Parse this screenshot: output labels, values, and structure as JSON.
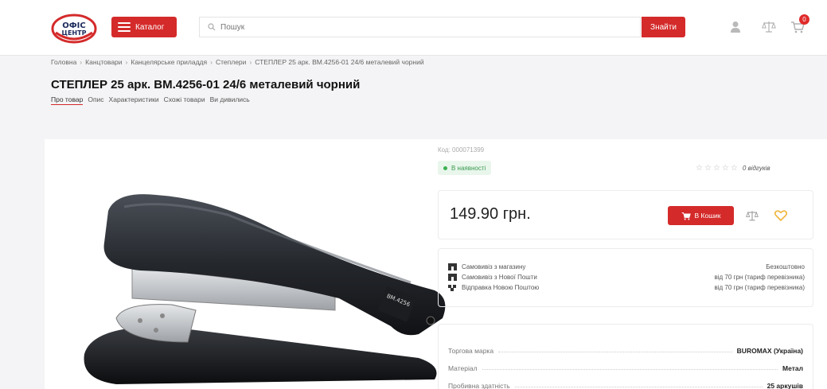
{
  "header": {
    "logo_line1": "ОФІС",
    "logo_line2": "ЦЕНТР",
    "catalog_label": "Каталог",
    "search_placeholder": "Пошук",
    "search_button": "Знайти",
    "cart_count": "0"
  },
  "breadcrumb": [
    "Головна",
    "Канцтовари",
    "Канцелярське приладдя",
    "Степлери",
    "СТЕПЛЕР 25 арк. BM.4256-01 24/6 металевий чорний"
  ],
  "product": {
    "title": "СТЕПЛЕР 25 арк. BM.4256-01 24/6 металевий чорний",
    "tabs": [
      "Про товар",
      "Опис",
      "Характеристики",
      "Схожі товари",
      "Ви дивились"
    ],
    "sku": "Код: 000071399",
    "stock": "В наявності",
    "reviews": "0 відгуків",
    "rating_stars": 0,
    "price": "149.90 грн.",
    "buy_label": "В Кошик",
    "delivery": [
      {
        "label": "Самовивіз з магазину",
        "value": "Безкоштовно"
      },
      {
        "label": "Самовивіз з Нової Пошти",
        "value": "від 70 грн (тариф перевізника)"
      },
      {
        "label": "Відправка Новою Поштою",
        "value": "від 70 грн (тариф перевізника)"
      }
    ],
    "specs": [
      {
        "name": "Торгова марка",
        "value": "BUROMAX (Україна)"
      },
      {
        "name": "Матеріал",
        "value": "Метал"
      },
      {
        "name": "Пробивна здатність",
        "value": "25 аркушів"
      }
    ],
    "image_label": "BM.4256"
  },
  "colors": {
    "brand_red": "#d42a2a",
    "stock_green": "#3ab150",
    "favorite_gold": "#f0b43a"
  },
  "icons": {
    "catalog": "burger-menu-icon",
    "search": "search-icon",
    "user": "user-icon",
    "compare": "scales-icon",
    "cart": "cart-icon",
    "favorite": "heart-icon"
  }
}
